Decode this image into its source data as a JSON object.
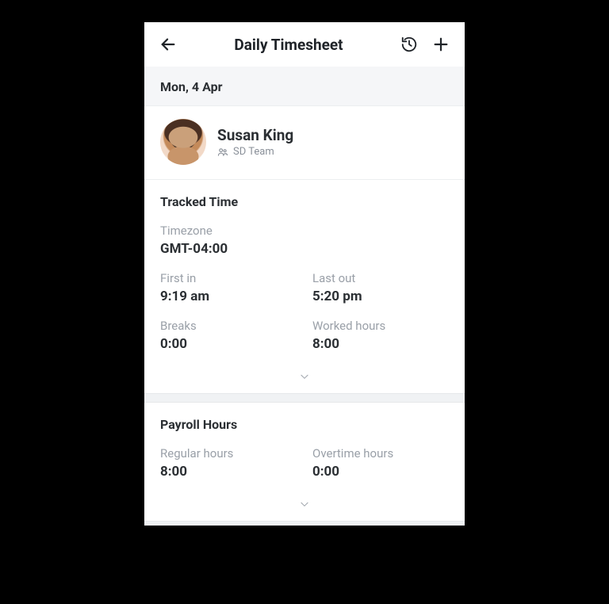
{
  "header": {
    "title": "Daily Timesheet"
  },
  "date": "Mon, 4 Apr",
  "user": {
    "name": "Susan King",
    "team": "SD Team"
  },
  "tracked": {
    "title": "Tracked Time",
    "timezone_label": "Timezone",
    "timezone_value": "GMT-04:00",
    "first_in_label": "First in",
    "first_in_value": "9:19 am",
    "last_out_label": "Last out",
    "last_out_value": "5:20 pm",
    "breaks_label": "Breaks",
    "breaks_value": "0:00",
    "worked_label": "Worked hours",
    "worked_value": "8:00"
  },
  "payroll": {
    "title": "Payroll Hours",
    "regular_label": "Regular hours",
    "regular_value": "8:00",
    "overtime_label": "Overtime hours",
    "overtime_value": "0:00"
  }
}
